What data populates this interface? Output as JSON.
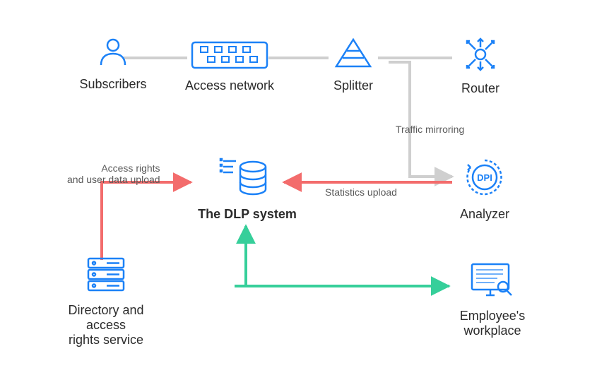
{
  "nodes": {
    "subscribers": "Subscribers",
    "access_network": "Access network",
    "splitter": "Splitter",
    "router": "Router",
    "dlp_system": "The DLP system",
    "analyzer": "Analyzer",
    "analyzer_badge": "DPI",
    "directory": "Directory and access\nrights service",
    "workplace": "Employee's workplace"
  },
  "edges": {
    "traffic_mirroring": "Traffic mirroring",
    "access_rights": "Access rights\nand user data upload",
    "statistics": "Statistics upload"
  },
  "colors": {
    "icon_blue": "#1B81F7",
    "line_gray": "#CFCFCF",
    "line_red": "#F36C6C",
    "line_green": "#36CF9A",
    "text": "#2b2b2b"
  }
}
